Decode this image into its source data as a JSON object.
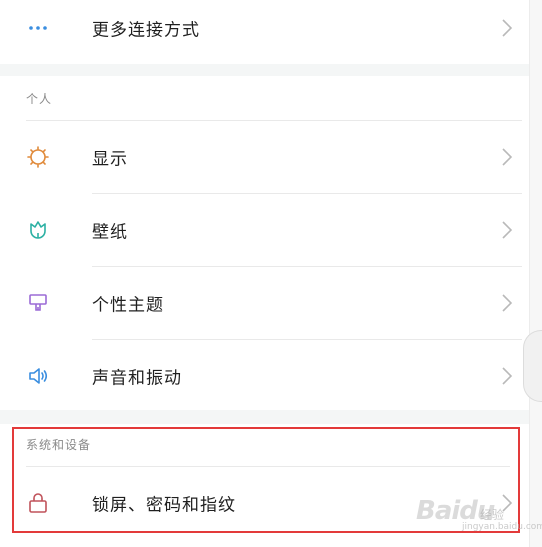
{
  "top_item": {
    "label": "更多连接方式",
    "icon": "more-dots-icon"
  },
  "sections": [
    {
      "header": "个人",
      "items": [
        {
          "label": "显示",
          "icon": "sun-icon",
          "icon_color": "#e08a3a"
        },
        {
          "label": "壁纸",
          "icon": "tulip-icon",
          "icon_color": "#2bb0a3"
        },
        {
          "label": "个性主题",
          "icon": "brush-icon",
          "icon_color": "#9b6bd6"
        },
        {
          "label": "声音和振动",
          "icon": "speaker-icon",
          "icon_color": "#3a8ee0"
        }
      ]
    },
    {
      "header": "系统和设备",
      "items": [
        {
          "label": "锁屏、密码和指纹",
          "icon": "lock-icon",
          "icon_color": "#c0525a"
        }
      ]
    }
  ],
  "annotation": {
    "highlight_color": "#e33a3a"
  },
  "watermark": {
    "text": "Baidu",
    "sub": "经验",
    "url": "jingyan.baidu.com"
  }
}
